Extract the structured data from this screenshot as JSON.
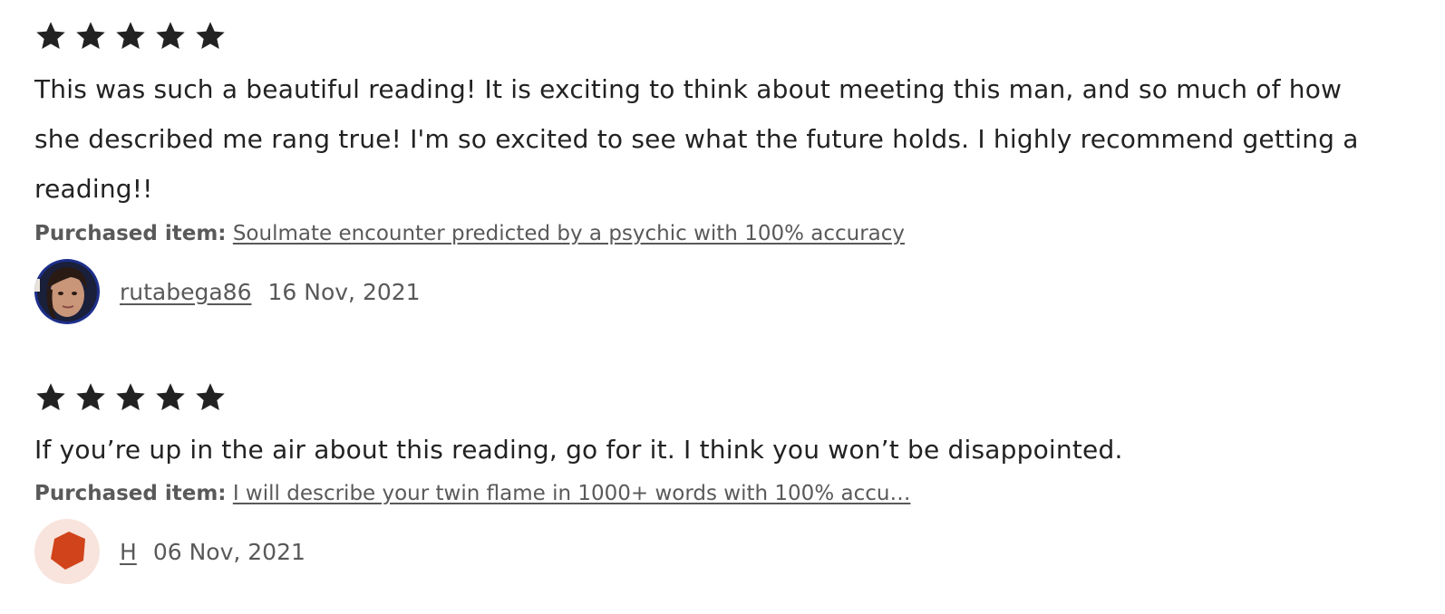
{
  "colors": {
    "text": "#222222",
    "muted": "#595959",
    "star": "#222222",
    "shop_icon": "#d1431a",
    "shop_icon_bg": "#f8e4dc"
  },
  "reviews": [
    {
      "rating": 5,
      "text": "This was such a beautiful reading! It is exciting to think about meeting this man, and so much of how she described me rang true! I'm so excited to see what the future holds. I highly recommend getting a reading!!",
      "purchased_label": "Purchased item:",
      "purchased_item": "Soulmate encounter predicted by a psychic with 100% accuracy",
      "author": "rutabega86",
      "date": "16 Nov, 2021",
      "avatar": "user-photo-avatar"
    },
    {
      "rating": 5,
      "text": "If you’re up in the air about this reading, go for it. I think you won’t be disappointed.",
      "purchased_label": "Purchased item:",
      "purchased_item": "I will describe your twin flame in 1000+ words with 100% accu…",
      "author": "H",
      "date": "06 Nov, 2021",
      "avatar": "default-shape-avatar"
    }
  ]
}
